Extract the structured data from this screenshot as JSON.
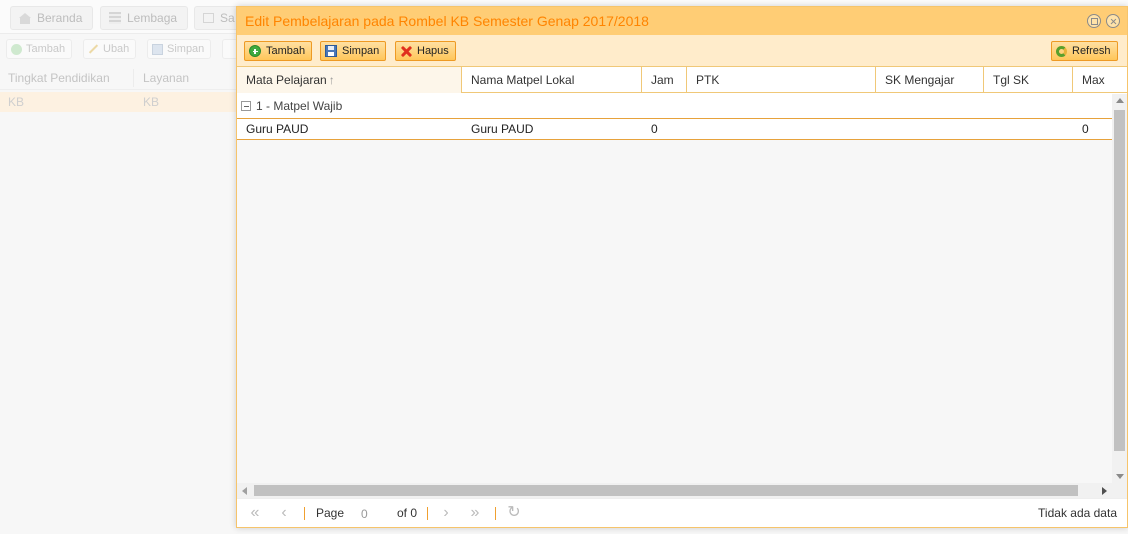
{
  "background": {
    "tabs": [
      {
        "label": "Beranda",
        "icon": "home-icon"
      },
      {
        "label": "Lembaga",
        "icon": "building-icon"
      },
      {
        "label": "Sa",
        "icon": "monitor-icon"
      }
    ],
    "toolbar": {
      "add_label": "Tambah",
      "edit_label": "Ubah",
      "save_label": "Simpan"
    },
    "grid": {
      "columns": [
        "Tingkat Pendidikan",
        "Layanan"
      ],
      "rows": [
        [
          "KB",
          "KB"
        ]
      ]
    }
  },
  "dialog": {
    "title": "Edit Pembelajaran pada Rombel KB Semester Genap 2017/2018",
    "toolbar": {
      "add_label": "Tambah",
      "save_label": "Simpan",
      "delete_label": "Hapus",
      "refresh_label": "Refresh"
    },
    "grid": {
      "columns": [
        "Mata Pelajaran",
        "Nama Matpel Lokal",
        "Jam",
        "PTK",
        "SK Mengajar",
        "Tgl SK",
        "Max"
      ],
      "sort_indicator": "↑",
      "group_label": "1 - Matpel Wajib",
      "rows": [
        {
          "mata_pelajaran": "Guru PAUD",
          "nama_matpel_lokal": "Guru PAUD",
          "jam": "0",
          "ptk": "",
          "sk_mengajar": "",
          "tgl_sk": "",
          "max": "0"
        }
      ]
    },
    "pager": {
      "page_label": "Page",
      "page_value": "0",
      "of_label": "of 0",
      "status": "Tidak ada data"
    }
  },
  "colors": {
    "header_bg": "#ffcd75",
    "title_text": "#ff8400",
    "toolbar_bg": "#ffeccb",
    "button_border": "#ee9a24",
    "row_border": "#e7a23b"
  }
}
